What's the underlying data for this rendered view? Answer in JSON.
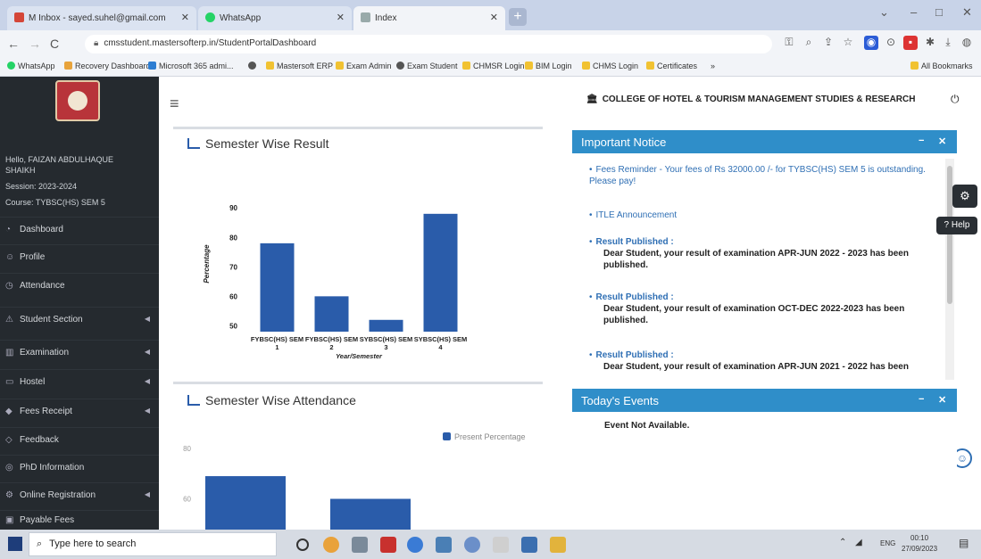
{
  "browser": {
    "tabs": [
      {
        "label": "M Inbox - sayed.suhel@gmail.com"
      },
      {
        "label": "WhatsApp"
      },
      {
        "label": "Index"
      }
    ],
    "url": "cmsstudent.mastersofterp.in/StudentPortalDashboard",
    "bookmarks": [
      "WhatsApp",
      "Recovery Dashboard",
      "Microsoft 365 admi...",
      "Mastersoft ERP",
      "Exam Admin",
      "Exam Student",
      "CHMSR Login",
      "BIM Login",
      "CHMS Login",
      "Certificates",
      "All Bookmarks"
    ]
  },
  "sidebar": {
    "greeting_line1": "Hello, FAIZAN ABDULHAQUE",
    "greeting_line2": "SHAIKH",
    "session": "Session: 2023-2024",
    "course": "Course: TYBSC(HS) SEM 5",
    "items": [
      {
        "label": "Dashboard",
        "icon": "dashboard-icon"
      },
      {
        "label": "Profile",
        "icon": "profile-icon"
      },
      {
        "label": "Attendance",
        "icon": "attendance-icon"
      },
      {
        "label": "Student Section",
        "icon": "student-icon"
      },
      {
        "label": "Examination",
        "icon": "exam-icon"
      },
      {
        "label": "Hostel",
        "icon": "hostel-icon"
      },
      {
        "label": "Fees Receipt",
        "icon": "fees-icon"
      },
      {
        "label": "Feedback",
        "icon": "feedback-icon"
      },
      {
        "label": "PhD Information",
        "icon": "phd-icon"
      },
      {
        "label": "Online Registration",
        "icon": "registration-icon"
      },
      {
        "label": "Payable Fees",
        "icon": "payable-icon"
      }
    ]
  },
  "header": {
    "college": "COLLEGE OF HOTEL & TOURISM MANAGEMENT STUDIES & RESEARCH"
  },
  "result_panel": {
    "title": "Semester Wise Result"
  },
  "attendance_panel": {
    "title": "Semester Wise Attendance",
    "legend": "Present Percentage"
  },
  "notice_panel": {
    "title": "Important Notice",
    "items": [
      {
        "link": "Fees Reminder - Your fees of Rs 32000.00 /- for TYBSC(HS) SEM 5 is outstanding. Please pay!",
        "body": ""
      },
      {
        "link": "ITLE Announcement",
        "body": ""
      },
      {
        "link": "Result Published :",
        "body": "Dear Student, your result of examination APR-JUN 2022 - 2023 has been published."
      },
      {
        "link": "Result Published :",
        "body": "Dear Student, your result of examination OCT-DEC 2022-2023 has been published."
      },
      {
        "link": "Result Published :",
        "body": "Dear Student, your result of examination APR-JUN 2021 - 2022 has been"
      }
    ]
  },
  "events_panel": {
    "title": "Today's Events",
    "empty": "Event Not Available."
  },
  "help_label": "Help",
  "taskbar": {
    "search_placeholder": "Type here to search",
    "lang": "ENG",
    "time": "00:10",
    "date": "27/09/2023"
  },
  "colors": {
    "bar": "#2a5caa",
    "notice_header": "#2f8ec9",
    "sidebar": "#252a2f"
  },
  "chart_data": [
    {
      "type": "bar",
      "title": "Semester Wise Result",
      "categories": [
        "FYBSC(HS) SEM 1",
        "FYBSC(HS) SEM 2",
        "SYBSC(HS) SEM 3",
        "SYBSC(HS) SEM 4"
      ],
      "values": [
        78,
        60,
        52,
        88
      ],
      "xlabel": "Year/Semester",
      "ylabel": "Percentage",
      "yticks": [
        50,
        60,
        70,
        80,
        90
      ],
      "ylim": [
        48,
        94
      ]
    },
    {
      "type": "bar",
      "title": "Semester Wise Attendance",
      "series": [
        {
          "name": "Present Percentage",
          "values": [
            69,
            60
          ]
        }
      ],
      "yticks": [
        40,
        60,
        80
      ],
      "ylim": [
        28,
        86
      ]
    }
  ]
}
